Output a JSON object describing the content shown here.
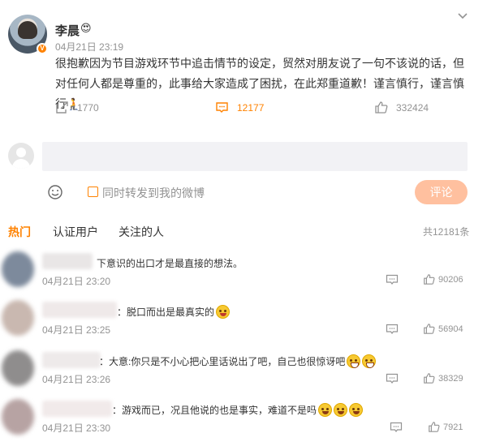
{
  "post": {
    "author": "李晨",
    "time": "04月21日 23:19",
    "text": "很抱歉因为节目游戏环节中追击情节的设定，贸然对朋友说了一句不该说的话，但对任何人都是尊重的，此事给大家造成了困扰，在此郑重道歉！谨言慎行，谨言慎行🧎",
    "reposts": "1770",
    "comments": "12177",
    "likes": "332424"
  },
  "comment_box": {
    "placeholder": "",
    "repost_label": "同时转发到我的微博",
    "submit_label": "评论"
  },
  "tabs": {
    "hot": "热门",
    "verified": "认证用户",
    "following": "关注的人",
    "total": "共12181条"
  },
  "comments": [
    {
      "text": "下意识的出口才是最直接的想法。",
      "time": "04月21日 23:20",
      "likes": "90206"
    },
    {
      "text": "：脱口而出是最真实的",
      "time": "04月21日 23:25",
      "likes": "56904"
    },
    {
      "text": "：大意:你只是不小心把心里话说出了吧，自己也很惊讶吧",
      "time": "04月21日 23:26",
      "likes": "38329"
    },
    {
      "text": "：游戏而已，况且他说的也是事实，难道不是吗",
      "time": "04月21日 23:30",
      "likes": "7921"
    }
  ],
  "colors": {
    "accent": "#ff8200",
    "muted": "#939393",
    "button_disabled": "#ffc09f"
  }
}
